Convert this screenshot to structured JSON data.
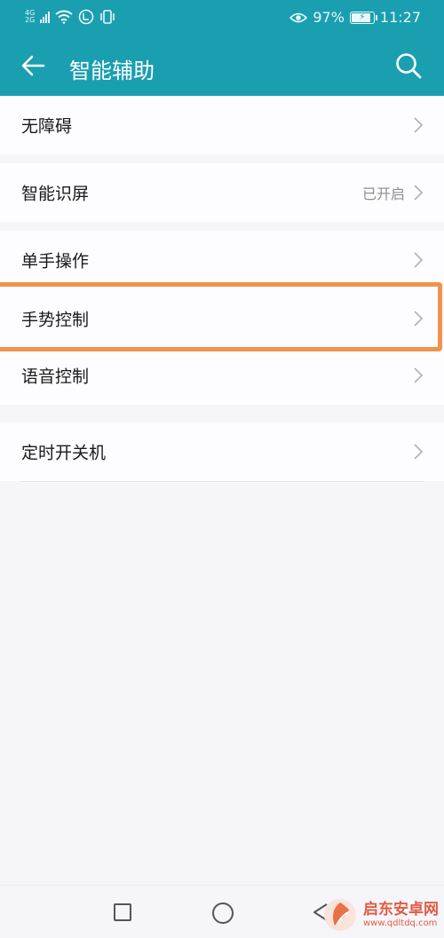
{
  "status_bar": {
    "network_top": "4G",
    "network_bottom": "2G",
    "battery_percent": "97%",
    "battery_level": 0.97,
    "time": "11:27"
  },
  "header": {
    "title": "智能辅助",
    "back_icon": "arrow-left-icon",
    "search_icon": "search-icon"
  },
  "groups": [
    {
      "items": [
        {
          "label": "无障碍"
        }
      ]
    },
    {
      "items": [
        {
          "label": "智能识屏",
          "value": "已开启"
        }
      ]
    },
    {
      "items": [
        {
          "label": "单手操作"
        },
        {
          "label": "手势控制"
        },
        {
          "label": "语音控制"
        }
      ]
    },
    {
      "items": [
        {
          "label": "定时开关机"
        }
      ]
    }
  ],
  "watermark": {
    "name": "启东安卓网",
    "url": "www.qdltdq.com"
  },
  "colors": {
    "header_bg": "#1a9fb1",
    "highlight_border": "#f0934c",
    "page_bg": "#f6f5fa"
  }
}
